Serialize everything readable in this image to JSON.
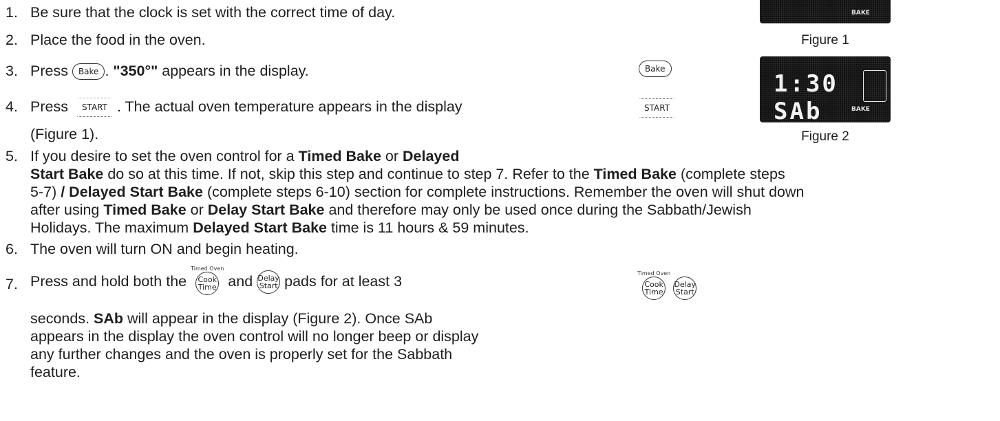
{
  "steps": {
    "s1": {
      "num": "1.",
      "text": "Be sure that the clock is set with the correct time of day."
    },
    "s2": {
      "num": "2.",
      "text": "Place the food in the oven."
    },
    "s3": {
      "num": "3.",
      "pre": "Press",
      "bold": "\"350°\"",
      "post": " appears in the display."
    },
    "s4": {
      "num": "4.",
      "pre": "Press",
      "post": ". The actual oven temperature appears in the display",
      "cont": "(Figure 1)."
    },
    "s5": {
      "num": "5.",
      "l1_pre": "If you desire to set the oven control for a ",
      "l1_b1": "Timed Bake",
      "l1_mid": " or ",
      "l1_b2": "Delayed",
      "l2_b": "Start Bake",
      "l2_mid": " do so at this time. If not, skip this step and continue to step 7. Refer to the ",
      "l2_b2": "Timed Bake",
      "l2_post": " (complete steps",
      "l3_pre": "5-7) ",
      "l3_b": "/ Delayed Start Bake",
      "l3_post": " (complete steps 6-10) section for complete instructions. Remember the oven will shut down",
      "l4_pre": "after using ",
      "l4_b1": "Timed Bake",
      "l4_mid": " or ",
      "l4_b2": "Delay Start Bake",
      "l4_post": " and therefore may only be used once during the Sabbath/Jewish",
      "l5_pre": "Holidays. The maximum ",
      "l5_b": "Delayed Start Bake",
      "l5_post": " time is 11 hours & 59 minutes."
    },
    "s6": {
      "num": "6.",
      "text": "The oven will turn ON and begin heating."
    },
    "s7": {
      "num": "7.",
      "pre": "Press and hold both the",
      "mid": " and ",
      "post": " pads for at least 3",
      "l2_pre": "seconds. ",
      "l2_b": "SAb",
      "l2_post": " will appear in the display (Figure 2). Once SAb",
      "l3": "appears in the display the oven control will no longer beep or display",
      "l4": "any further changes and the oven is properly set for the Sabbath",
      "l5": "feature."
    }
  },
  "pads": {
    "bake": "Bake",
    "start": "START",
    "timed_oven": "Timed Oven",
    "cook_1": "Cook",
    "cook_2": "Time",
    "delay_1": "Delay",
    "delay_2": "Start"
  },
  "figures": {
    "fig1": {
      "label": "BAKE",
      "caption": "Figure 1"
    },
    "fig2": {
      "readout": "1:30 SAb",
      "label": "BAKE",
      "caption": "Figure 2"
    }
  }
}
